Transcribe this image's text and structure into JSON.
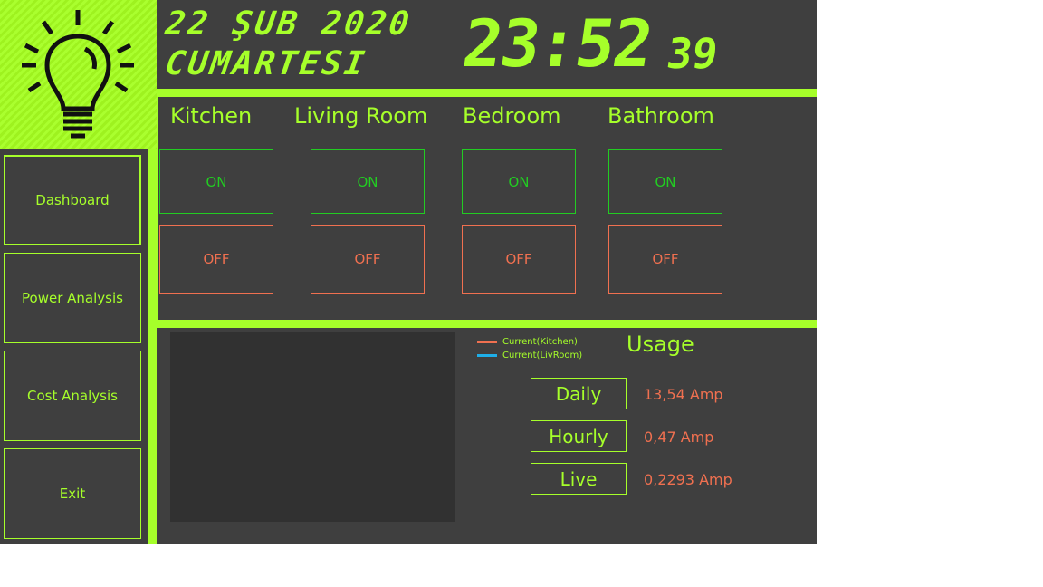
{
  "header": {
    "date_line": "22 ŞUB 2020",
    "day_line": "CUMARTESI",
    "time_hm": "23:52",
    "time_s": "39"
  },
  "logo": {
    "icon": "lightbulb-icon"
  },
  "sidebar": {
    "items": [
      {
        "label": "Dashboard",
        "active": true
      },
      {
        "label": "Power Analysis"
      },
      {
        "label": "Cost Analysis"
      },
      {
        "label": "Exit"
      }
    ]
  },
  "rooms": [
    {
      "name": "Kitchen",
      "on_label": "ON",
      "off_label": "OFF"
    },
    {
      "name": "Living Room",
      "on_label": "ON",
      "off_label": "OFF"
    },
    {
      "name": "Bedroom",
      "on_label": "ON",
      "off_label": "OFF"
    },
    {
      "name": "Bathroom",
      "on_label": "ON",
      "off_label": "OFF"
    }
  ],
  "legend": [
    {
      "label": "Current(Kitchen)",
      "color": "#f07050"
    },
    {
      "label": "Current(LivRoom)",
      "color": "#1eaee8"
    }
  ],
  "usage": {
    "title": "Usage",
    "rows": [
      {
        "label": "Daily",
        "value": "13,54 Amp"
      },
      {
        "label": "Hourly",
        "value": "0,47 Amp"
      },
      {
        "label": "Live",
        "value": "0,2293 Amp"
      }
    ]
  },
  "colors": {
    "accent": "#a6ff2a",
    "on": "#22cc22",
    "off": "#f07050",
    "panel": "#3f3f3f"
  }
}
